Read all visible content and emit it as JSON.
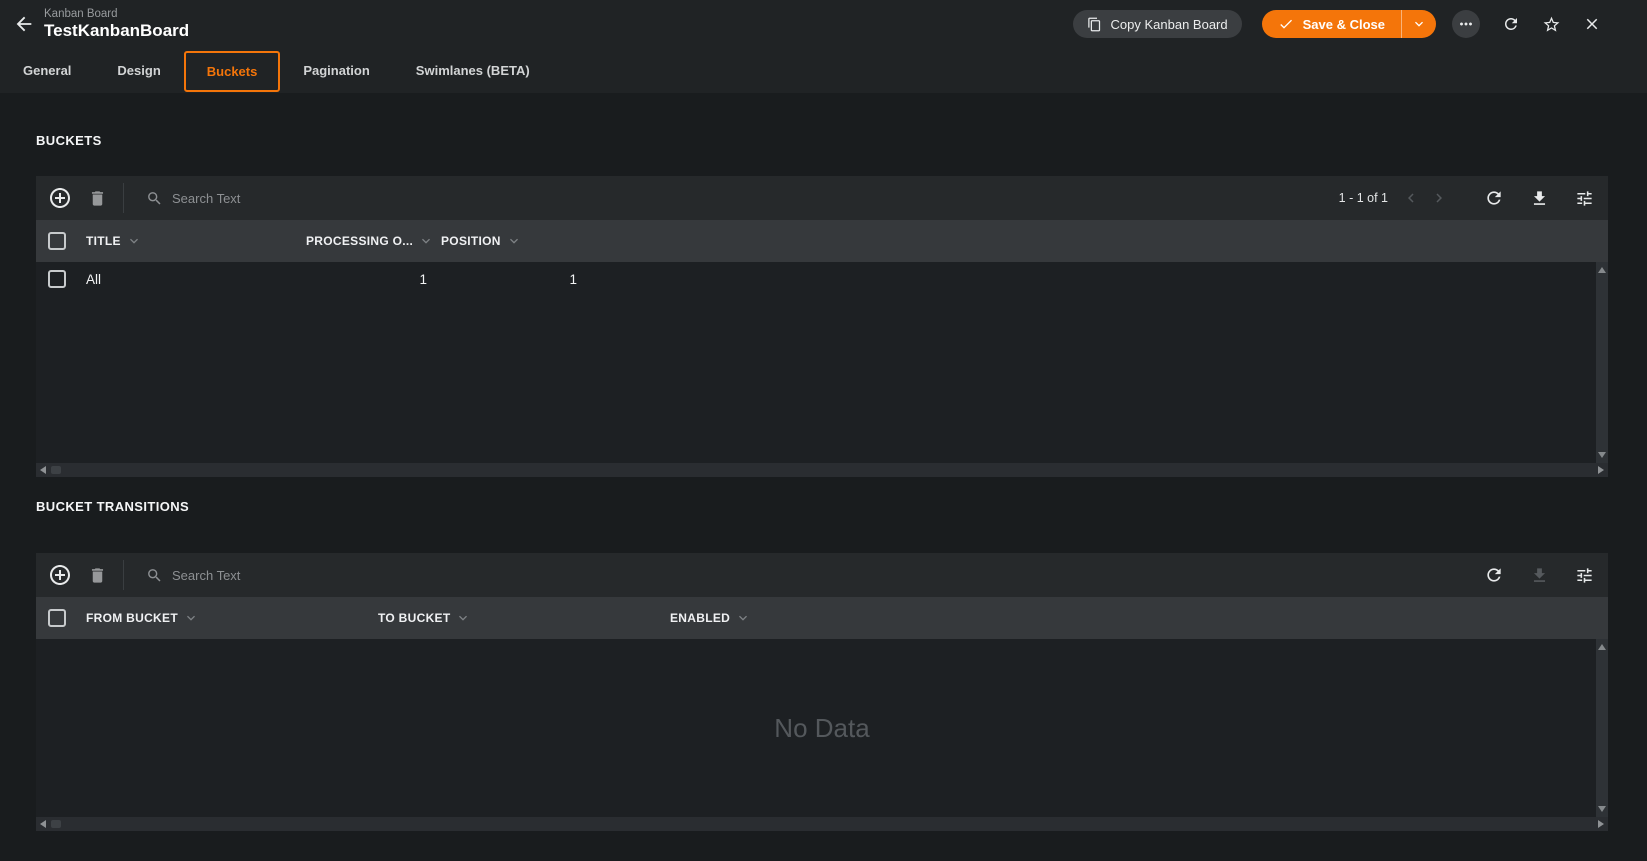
{
  "colors": {
    "accent": "#f4750a"
  },
  "topbar": {
    "breadcrumb": "Kanban Board",
    "title": "TestKanbanBoard",
    "copy_button_label": "Copy Kanban Board",
    "save_button_label": "Save & Close"
  },
  "tabs": [
    {
      "label": "General"
    },
    {
      "label": "Design"
    },
    {
      "label": "Buckets"
    },
    {
      "label": "Pagination"
    },
    {
      "label": "Swimlanes (BETA)"
    }
  ],
  "active_tab": "Buckets",
  "buckets_section": {
    "heading": "BUCKETS",
    "search_placeholder": "Search Text",
    "pagination_label": "1 - 1 of 1",
    "columns": [
      {
        "label": "TITLE"
      },
      {
        "label": "PROCESSING O..."
      },
      {
        "label": "POSITION"
      }
    ],
    "rows": [
      {
        "title": "All",
        "processing_order": "1",
        "position": "1"
      }
    ]
  },
  "transitions_section": {
    "heading": "BUCKET TRANSITIONS",
    "search_placeholder": "Search Text",
    "columns": [
      {
        "label": "FROM BUCKET"
      },
      {
        "label": "TO BUCKET"
      },
      {
        "label": "ENABLED"
      }
    ],
    "empty_text": "No Data"
  }
}
